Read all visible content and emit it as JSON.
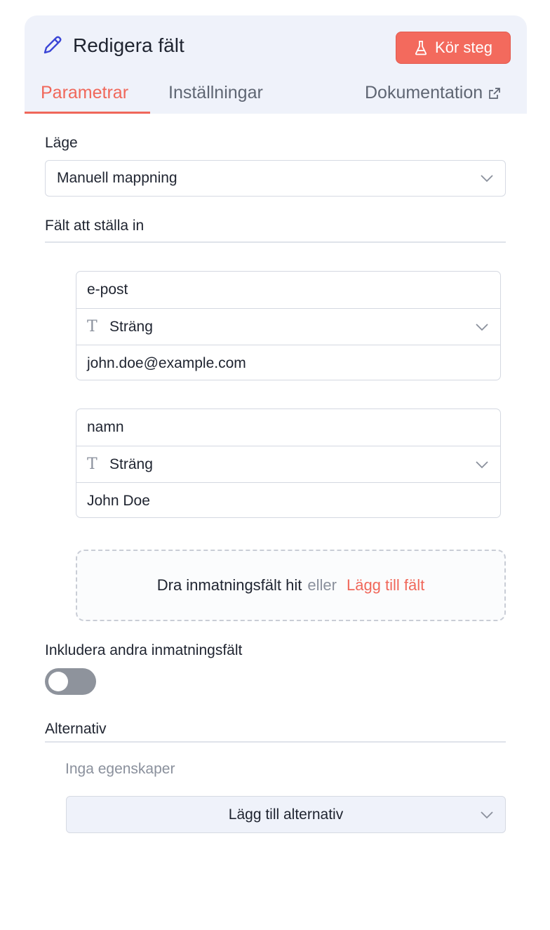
{
  "header": {
    "title": "Redigera fält",
    "title_icon": "pencil-icon",
    "run_button": {
      "label": "Kör steg",
      "icon": "flask-icon"
    },
    "tabs": [
      {
        "label": "Parametrar",
        "active": true
      },
      {
        "label": "Inställningar",
        "active": false
      },
      {
        "label": "Dokumentation",
        "icon": "external-link-icon",
        "active": false
      }
    ]
  },
  "mode": {
    "label": "Läge",
    "value": "Manuell mappning"
  },
  "fields_section": {
    "label": "Fält att ställa in",
    "fields": [
      {
        "name": "e-post",
        "type": "Sträng",
        "type_icon": "text-type-icon",
        "value": "john.doe@example.com"
      },
      {
        "name": "namn",
        "type": "Sträng",
        "type_icon": "text-type-icon",
        "value": "John Doe"
      }
    ],
    "dropzone": {
      "text": "Dra inmatningsfält hit",
      "or": "eller",
      "link": "Lägg till fält"
    }
  },
  "include_other": {
    "label": "Inkludera andra inmatningsfält",
    "enabled": false
  },
  "options": {
    "label": "Alternativ",
    "empty_text": "Inga egenskaper",
    "add_button": "Lägg till alternativ"
  },
  "colors": {
    "accent": "#f0675a",
    "header_bg": "#eff2fa",
    "toggle_off": "#8e939c",
    "icon_blue": "#3b46d6"
  }
}
